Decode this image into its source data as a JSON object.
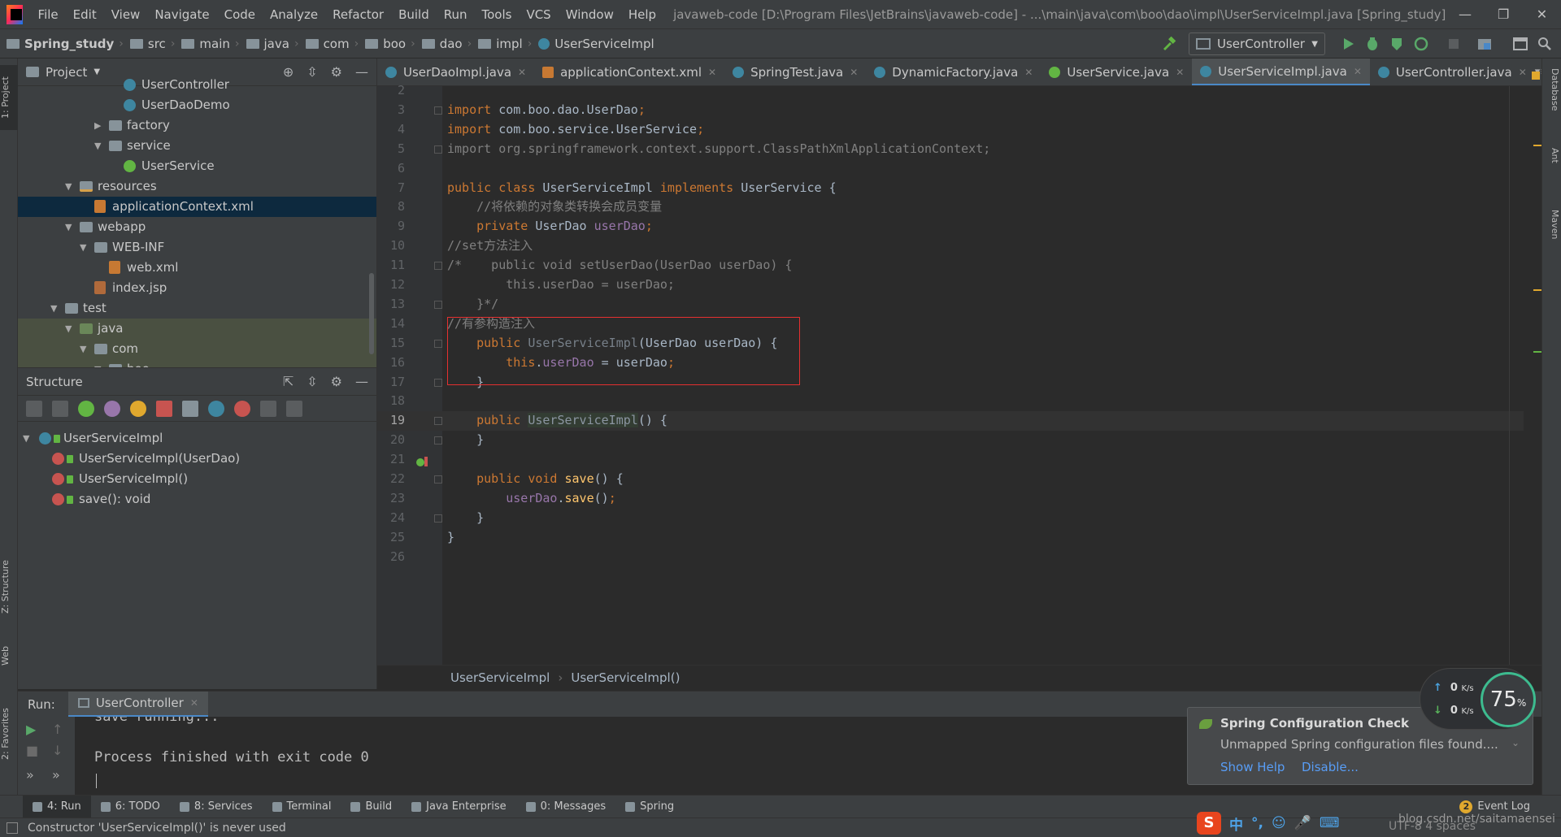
{
  "menubar": {
    "items": [
      "File",
      "Edit",
      "View",
      "Navigate",
      "Code",
      "Analyze",
      "Refactor",
      "Build",
      "Run",
      "Tools",
      "VCS",
      "Window",
      "Help"
    ],
    "title": "javaweb-code [D:\\Program Files\\JetBrains\\javaweb-code] - ...\\main\\java\\com\\boo\\dao\\impl\\UserServiceImpl.java [Spring_study]",
    "minimize": "—",
    "restore": "❐",
    "close": "✕"
  },
  "navbar": {
    "crumbs": [
      "Spring_study",
      "src",
      "main",
      "java",
      "com",
      "boo",
      "dao",
      "impl",
      "UserServiceImpl"
    ],
    "run_config": "UserController"
  },
  "left_strip": {
    "project": "1: Project",
    "structure": "Z: Structure",
    "web": "Web",
    "favorites": "2: Favorites"
  },
  "right_strip": {
    "database": "Database",
    "ant": "Ant",
    "maven": "Maven"
  },
  "project_panel": {
    "title": "Project",
    "rows": [
      {
        "label": "UserController",
        "depth": 4,
        "icon": "class",
        "arrow": ""
      },
      {
        "label": "UserDaoDemo",
        "depth": 4,
        "icon": "class",
        "arrow": ""
      },
      {
        "label": "factory",
        "depth": 3,
        "icon": "folder",
        "arrow": "▶"
      },
      {
        "label": "service",
        "depth": 3,
        "icon": "folder",
        "arrow": "▼"
      },
      {
        "label": "UserService",
        "depth": 4,
        "icon": "iface",
        "arrow": ""
      },
      {
        "label": "resources",
        "depth": 1,
        "icon": "folder-res",
        "arrow": "▼"
      },
      {
        "label": "applicationContext.xml",
        "depth": 2,
        "icon": "xml",
        "arrow": ""
      },
      {
        "label": "webapp",
        "depth": 1,
        "icon": "folder",
        "arrow": "▼"
      },
      {
        "label": "WEB-INF",
        "depth": 2,
        "icon": "folder",
        "arrow": "▼"
      },
      {
        "label": "web.xml",
        "depth": 3,
        "icon": "xml",
        "arrow": ""
      },
      {
        "label": "index.jsp",
        "depth": 2,
        "icon": "jsp",
        "arrow": ""
      },
      {
        "label": "test",
        "depth": 0,
        "icon": "folder",
        "arrow": "▼"
      },
      {
        "label": "java",
        "depth": 1,
        "icon": "folder-test",
        "arrow": "▼"
      },
      {
        "label": "com",
        "depth": 2,
        "icon": "folder",
        "arrow": "▼"
      },
      {
        "label": "boo",
        "depth": 3,
        "icon": "folder",
        "arrow": "▼"
      }
    ]
  },
  "structure_panel": {
    "title": "Structure",
    "root": "UserServiceImpl",
    "members": [
      "UserServiceImpl(UserDao)",
      "UserServiceImpl()",
      "save(): void"
    ]
  },
  "editor": {
    "tabs": [
      {
        "label": "UserDaoImpl.java",
        "icon": "class",
        "active": false
      },
      {
        "label": "applicationContext.xml",
        "icon": "xml",
        "active": false
      },
      {
        "label": "SpringTest.java",
        "icon": "class",
        "active": false
      },
      {
        "label": "DynamicFactory.java",
        "icon": "class",
        "active": false
      },
      {
        "label": "UserService.java",
        "icon": "iface",
        "active": false
      },
      {
        "label": "UserServiceImpl.java",
        "icon": "class",
        "active": true
      },
      {
        "label": "UserController.java",
        "icon": "class",
        "active": false
      }
    ],
    "lines": [
      {
        "n": "2",
        "tokens": []
      },
      {
        "n": "3",
        "fold": true,
        "tokens": [
          [
            "kw",
            "import "
          ],
          [
            "id",
            "com.boo.dao.UserDao"
          ],
          [
            "kw",
            ";"
          ]
        ]
      },
      {
        "n": "4",
        "tokens": [
          [
            "kw",
            "import "
          ],
          [
            "id",
            "com.boo.service.UserService"
          ],
          [
            "kw",
            ";"
          ]
        ]
      },
      {
        "n": "5",
        "fold": true,
        "tokens": [
          [
            "gray",
            "import org.springframework.context.support.ClassPathXmlApplicationContext;"
          ]
        ]
      },
      {
        "n": "6",
        "tokens": []
      },
      {
        "n": "7",
        "tokens": [
          [
            "kw",
            "public class "
          ],
          [
            "id",
            "UserServiceImpl "
          ],
          [
            "kw",
            "implements "
          ],
          [
            "id",
            "UserService {"
          ]
        ]
      },
      {
        "n": "8",
        "tokens": [
          [
            "cmt",
            "    //将依赖的对象类转换会成员变量"
          ]
        ]
      },
      {
        "n": "9",
        "tokens": [
          [
            "kw",
            "    private "
          ],
          [
            "id",
            "UserDao "
          ],
          [
            "field",
            "userDao"
          ],
          [
            "kw",
            ";"
          ]
        ]
      },
      {
        "n": "10",
        "tokens": [
          [
            "cmt",
            "//set方法注入"
          ]
        ]
      },
      {
        "n": "11",
        "fold": true,
        "tokens": [
          [
            "cmt",
            "/*    public void setUserDao(UserDao userDao) {"
          ]
        ]
      },
      {
        "n": "12",
        "tokens": [
          [
            "cmt",
            "        this.userDao = userDao;"
          ]
        ]
      },
      {
        "n": "13",
        "fold": true,
        "tokens": [
          [
            "cmt",
            "    }*/"
          ]
        ]
      },
      {
        "n": "14",
        "tokens": [
          [
            "cmt",
            "//有参构造注入"
          ]
        ]
      },
      {
        "n": "15",
        "fold": true,
        "tokens": [
          [
            "kw",
            "    public "
          ],
          [
            "unused",
            "UserServiceImpl"
          ],
          [
            "id",
            "(UserDao userDao) {"
          ]
        ]
      },
      {
        "n": "16",
        "tokens": [
          [
            "kw",
            "        this"
          ],
          [
            "id",
            "."
          ],
          [
            "field",
            "userDao "
          ],
          [
            "id",
            "= userDao"
          ],
          [
            "kw",
            ";"
          ]
        ]
      },
      {
        "n": "17",
        "fold": true,
        "tokens": [
          [
            "id",
            "    }"
          ]
        ]
      },
      {
        "n": "18",
        "tokens": []
      },
      {
        "n": "19",
        "fold": true,
        "current": true,
        "tokens": [
          [
            "kw",
            "    public "
          ],
          [
            "ctorhl",
            "UserServiceImpl"
          ],
          [
            "id",
            "() {"
          ]
        ]
      },
      {
        "n": "20",
        "fold": true,
        "tokens": [
          [
            "id",
            "    }"
          ]
        ]
      },
      {
        "n": "21",
        "tokens": []
      },
      {
        "n": "22",
        "fold": true,
        "tokens": [
          [
            "kw",
            "    public void "
          ],
          [
            "method",
            "save"
          ],
          [
            "id",
            "() {"
          ]
        ]
      },
      {
        "n": "23",
        "tokens": [
          [
            "field",
            "        userDao"
          ],
          [
            "id",
            "."
          ],
          [
            "method",
            "save"
          ],
          [
            "id",
            "()"
          ],
          [
            "kw",
            ";"
          ]
        ]
      },
      {
        "n": "24",
        "fold": true,
        "tokens": [
          [
            "id",
            "    }"
          ]
        ]
      },
      {
        "n": "25",
        "tokens": [
          [
            "id",
            "}"
          ]
        ]
      },
      {
        "n": "26",
        "tokens": []
      }
    ],
    "breadcrumb": [
      "UserServiceImpl",
      "UserServiceImpl()"
    ]
  },
  "run_panel": {
    "label": "Run:",
    "tab": "UserController",
    "console": [
      "save running...",
      "",
      "Process finished with exit code 0"
    ]
  },
  "tool_tabs": {
    "items": [
      "4: Run",
      "6: TODO",
      "8: Services",
      "Terminal",
      "Build",
      "Java Enterprise",
      "0: Messages",
      "Spring"
    ],
    "event_log": "Event Log",
    "event_count": "2"
  },
  "statusbar": {
    "message": "Constructor 'UserServiceImpl()' is never used",
    "right": "UTF-8   4 spaces"
  },
  "notification": {
    "title": "Spring Configuration Check",
    "body": "Unmapped Spring configuration files found....",
    "help": "Show Help",
    "disable": "Disable..."
  },
  "net_widget": {
    "up": "0",
    "down": "0",
    "unit": "K/s",
    "percent": "75",
    "percent_sign": "%"
  },
  "ime": {
    "logo": "S",
    "glyphs": [
      "中",
      "°,",
      "☺",
      "🎤",
      "⌨"
    ]
  },
  "watermark": "blog.csdn.net/saitamaensei"
}
